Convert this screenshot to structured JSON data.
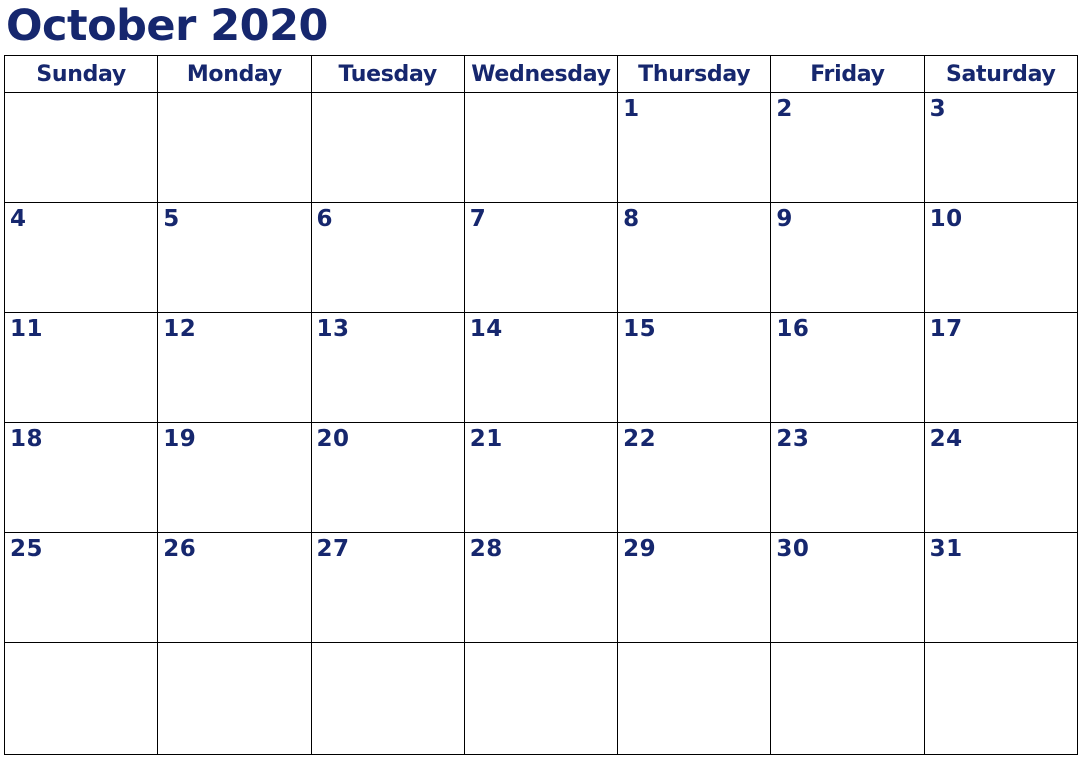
{
  "title": "October 2020",
  "colors": {
    "ink": "#16276e",
    "grid": "#000000",
    "background": "#ffffff"
  },
  "weekday_headers": [
    "Sunday",
    "Monday",
    "Tuesday",
    "Wednesday",
    "Thursday",
    "Friday",
    "Saturday"
  ],
  "weeks": [
    {
      "days": [
        {
          "num": ""
        },
        {
          "num": ""
        },
        {
          "num": ""
        },
        {
          "num": ""
        },
        {
          "num": "1"
        },
        {
          "num": "2"
        },
        {
          "num": "3"
        }
      ]
    },
    {
      "days": [
        {
          "num": "4"
        },
        {
          "num": "5"
        },
        {
          "num": "6"
        },
        {
          "num": "7"
        },
        {
          "num": "8"
        },
        {
          "num": "9"
        },
        {
          "num": "10"
        }
      ]
    },
    {
      "days": [
        {
          "num": "11"
        },
        {
          "num": "12"
        },
        {
          "num": "13"
        },
        {
          "num": "14"
        },
        {
          "num": "15"
        },
        {
          "num": "16"
        },
        {
          "num": "17"
        }
      ]
    },
    {
      "days": [
        {
          "num": "18"
        },
        {
          "num": "19"
        },
        {
          "num": "20"
        },
        {
          "num": "21"
        },
        {
          "num": "22"
        },
        {
          "num": "23"
        },
        {
          "num": "24"
        }
      ]
    },
    {
      "days": [
        {
          "num": "25"
        },
        {
          "num": "26"
        },
        {
          "num": "27"
        },
        {
          "num": "28"
        },
        {
          "num": "29"
        },
        {
          "num": "30"
        },
        {
          "num": "31"
        }
      ]
    },
    {
      "days": [
        {
          "num": ""
        },
        {
          "num": ""
        },
        {
          "num": ""
        },
        {
          "num": ""
        },
        {
          "num": ""
        },
        {
          "num": ""
        },
        {
          "num": ""
        }
      ]
    }
  ]
}
